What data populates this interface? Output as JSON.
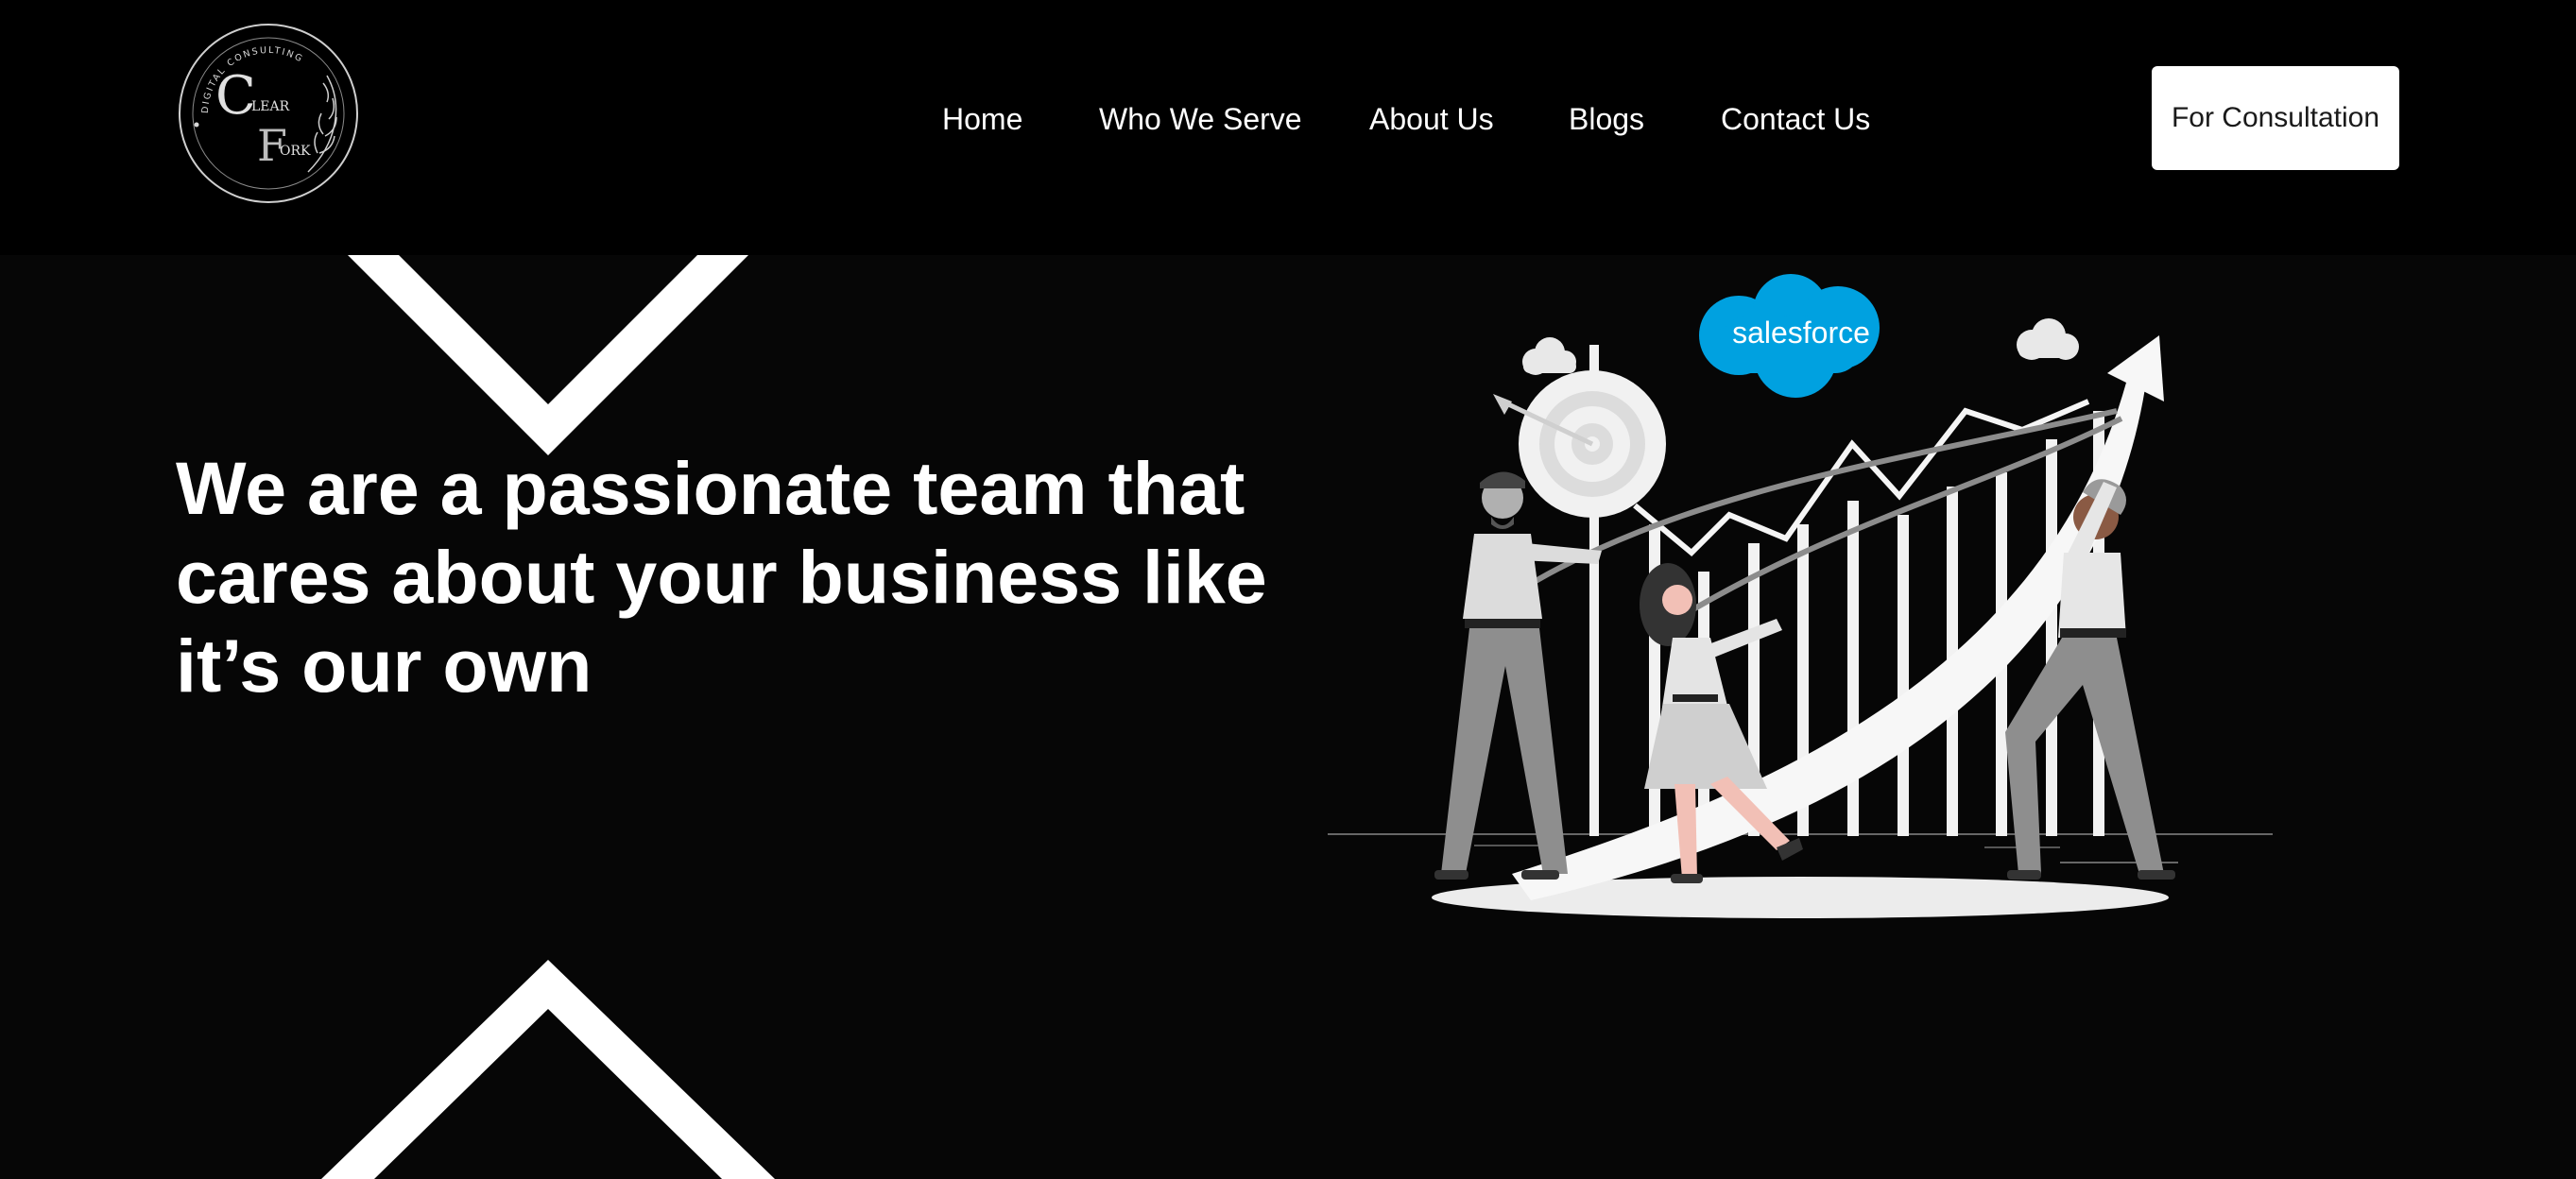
{
  "logo": {
    "ring_text": "DIGITAL CONSULTING",
    "letter_c": "C",
    "word_lear": "LEAR",
    "letter_f": "F",
    "word_ork": "ORK"
  },
  "nav": {
    "items": [
      {
        "label": "Home"
      },
      {
        "label": "Who We Serve"
      },
      {
        "label": "About Us"
      },
      {
        "label": "Blogs"
      },
      {
        "label": "Contact Us"
      }
    ],
    "cta_label": "For Consultation"
  },
  "hero": {
    "headline_line1": "We are a passionate team that",
    "headline_line2": "cares about your business like",
    "headline_line3": "it’s our own"
  },
  "illustration": {
    "badge_text": "salesforce"
  },
  "colors": {
    "background": "#000000",
    "hero_background": "#060606",
    "text": "#ffffff",
    "cta_background": "#ffffff",
    "cta_text": "#1a1a1a",
    "salesforce_blue": "#00a1e0"
  },
  "icons": [
    "clear-fork-logo",
    "chevron-down-shape",
    "chevron-up-shape",
    "salesforce-cloud-icon",
    "target-icon",
    "growth-arrow-icon"
  ]
}
